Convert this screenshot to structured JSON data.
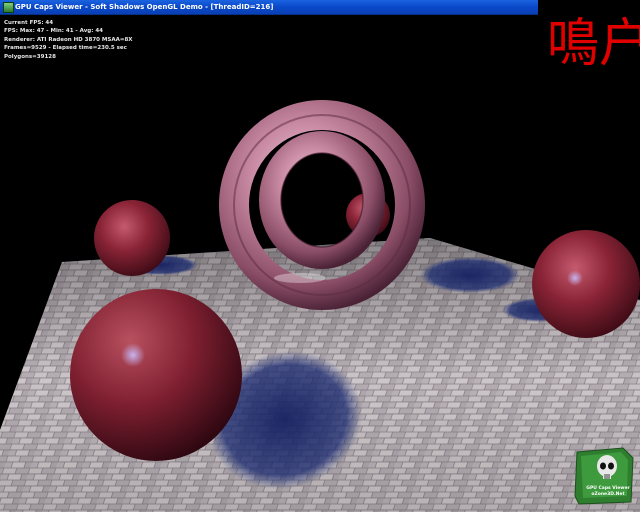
{
  "window": {
    "title": "GPU Caps Viewer - Soft Shadows OpenGL Demo - [ThreadID=216]"
  },
  "hud": {
    "lines": [
      "Current FPS: 44",
      "FPS: Max: 47 - Min: 41 - Avg: 44",
      "Renderer: ATI Radeon HD 3870  MSAA=8X",
      "Frames=9529 - Elapsed time=230.5 sec",
      "Polygons=39128"
    ]
  },
  "logo": {
    "text": "鳴户",
    "color": "#e00000"
  },
  "badge": {
    "line1": "GPU Caps Viewer",
    "line2": "oZone3D.Net"
  },
  "scene": {
    "background": "#000000",
    "floor_color": "#c9c2c6",
    "sphere_color": "#8a2436",
    "torus_color": "#c98aa3",
    "shadow_color": "#1a2a66"
  }
}
